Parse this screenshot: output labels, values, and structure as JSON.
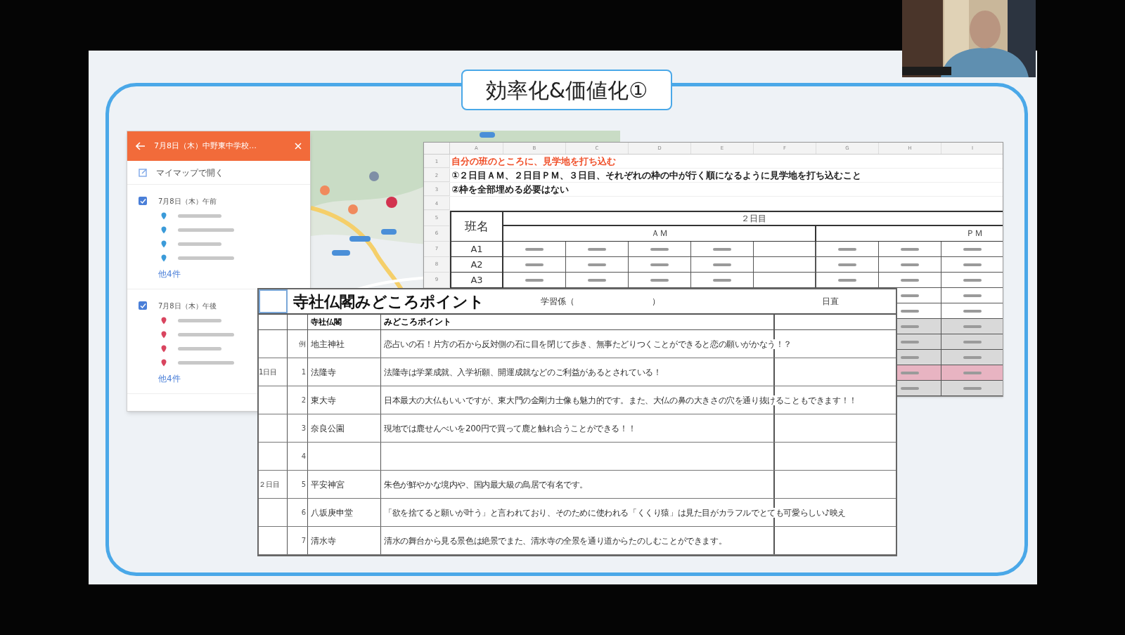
{
  "slide": {
    "title": "効率化&価値化①"
  },
  "map_panel": {
    "header": "7月8日（木）中野東中学校…",
    "open_link": "マイマップで開く",
    "layers": [
      {
        "label": "7月8日（木）午前",
        "checked": true,
        "color": "#3b9bd9",
        "more": "他4件"
      },
      {
        "label": "7月8日（木）午後",
        "checked": true,
        "color": "#d9455f",
        "more": "他4件"
      }
    ]
  },
  "sheet_back": {
    "columns": [
      "A",
      "B",
      "C",
      "D",
      "E",
      "F",
      "G",
      "H",
      "I"
    ],
    "row_numbers": [
      "1",
      "2",
      "3",
      "4",
      "5",
      "6",
      "7",
      "8",
      "9"
    ],
    "instruction": "自分の班のところに、見学地を打ち込む",
    "notes": [
      "①２日目ＡＭ、２日目ＰＭ、３日目、それぞれの枠の中が行く順になるように見学地を打ち込むこと",
      "②枠を全部埋める必要はない"
    ],
    "team_header": "班名",
    "day_header": "２日目",
    "am": "ＡＭ",
    "pm": "ＰＭ",
    "teams": [
      "A1",
      "A2",
      "A3"
    ],
    "lower_rows": [
      {
        "color": "#ffffff"
      },
      {
        "color": "#ffffff"
      },
      {
        "color": "#d9d9d9"
      },
      {
        "color": "#d9d9d9"
      },
      {
        "color": "#d9d9d9"
      },
      {
        "color": "#e8b4c2"
      },
      {
        "color": "#d9d9d9"
      }
    ]
  },
  "sheet_front": {
    "title": "寺社仏閣みどころポイント",
    "recorder_label": "学習係（",
    "recorder_close": "）",
    "right_label": "日直",
    "headers": [
      "寺社仏閣",
      "みどころポイント"
    ],
    "rows": [
      {
        "day": "",
        "no": "例",
        "place": "地主神社",
        "point": "恋占いの石！片方の石から反対側の石に目を閉じて歩き、無事たどりつくことができると恋の願いがかなう！？"
      },
      {
        "day": "1日目",
        "no": "1",
        "place": "法隆寺",
        "point": "法隆寺は学業成就、入学祈願、開運成就などのご利益があるとされている！"
      },
      {
        "day": "",
        "no": "2",
        "place": "東大寺",
        "point": "日本最大の大仏もいいですが、東大門の金剛力士像も魅力的です。また、大仏の鼻の大きさの穴を通り抜けることもできます！！"
      },
      {
        "day": "",
        "no": "3",
        "place": "奈良公園",
        "point": "現地では鹿せんべいを200円で買って鹿と触れ合うことができる！！"
      },
      {
        "day": "",
        "no": "4",
        "place": "",
        "point": ""
      },
      {
        "day": "２日目",
        "no": "5",
        "place": "平安神宮",
        "point": "朱色が鮮やかな境内や、国内最大級の鳥居で有名です。"
      },
      {
        "day": "",
        "no": "6",
        "place": "八坂庚申堂",
        "point": "「欲を捨てると願いが叶う」と言われており、そのために使われる「くくり猿」は見た目がカラフルでとても可愛らしい♪映え"
      },
      {
        "day": "",
        "no": "7",
        "place": "清水寺",
        "point": "清水の舞台から見る景色は絶景でまた、清水寺の全景を通り道からたのしむことができます。"
      }
    ]
  }
}
